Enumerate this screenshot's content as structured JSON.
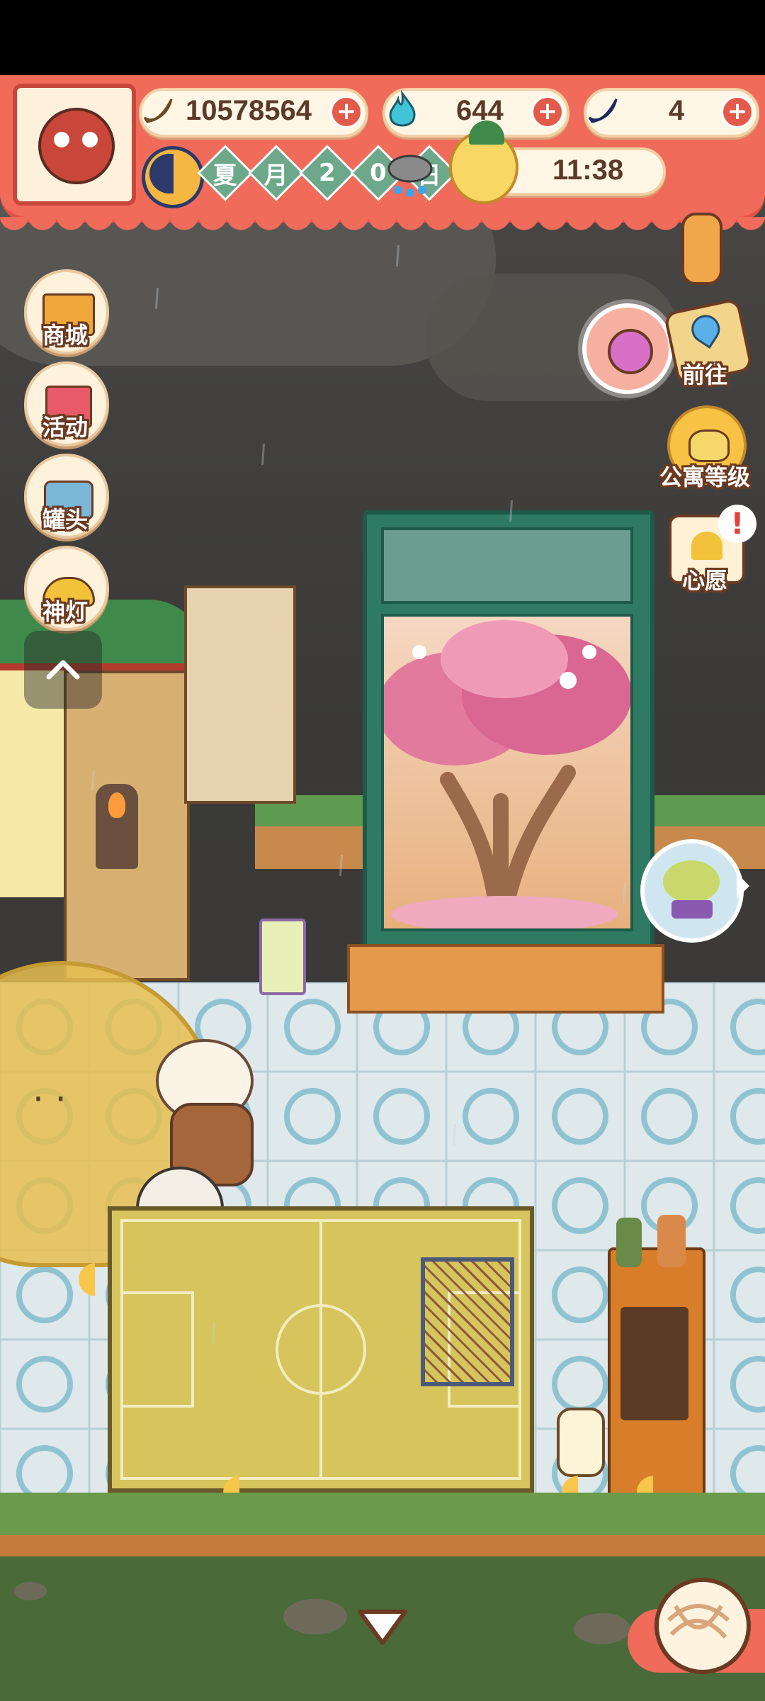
{
  "hud": {
    "bananas": "10578564",
    "fire_gems": "644",
    "blue_bananas": "4",
    "season": [
      "夏",
      "月",
      "2",
      "0",
      "日"
    ],
    "clock": "11:38",
    "weather_icon": "rain-cloud-icon"
  },
  "left_menu": [
    {
      "label": "商城",
      "icon": "shop-icon"
    },
    {
      "label": "活动",
      "icon": "gift-icon"
    },
    {
      "label": "罐头",
      "icon": "can-icon"
    },
    {
      "label": "神灯",
      "icon": "magic-lamp-icon"
    }
  ],
  "right_menu": {
    "goto": "前往",
    "apartment_level": "公寓等级",
    "wish": "心愿",
    "alert": "!"
  },
  "colors": {
    "hud_red": "#f06b5a",
    "banana": "#f7c64a",
    "fire": "#42c4d8",
    "cabinet_green": "#2f7a63"
  }
}
